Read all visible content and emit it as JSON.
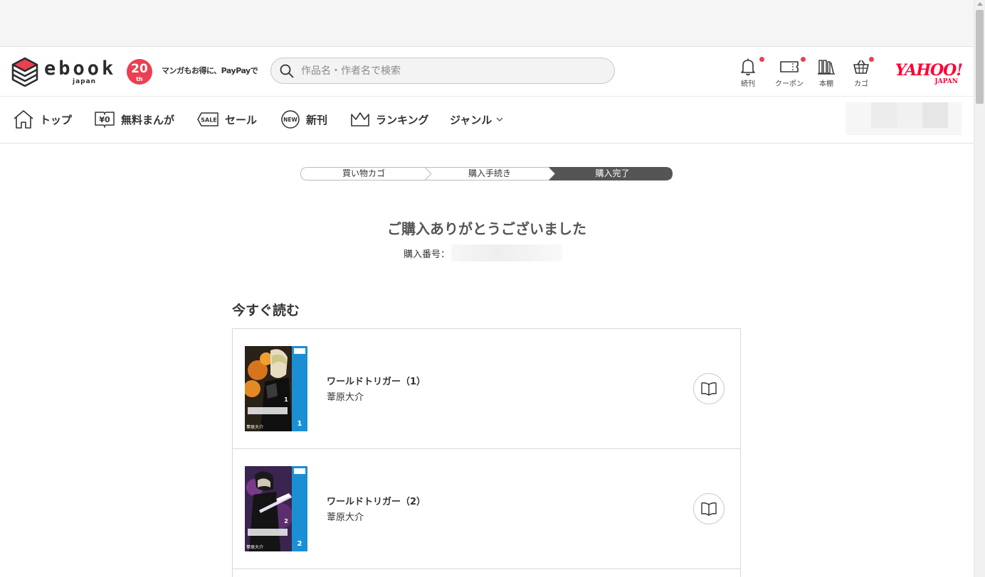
{
  "header": {
    "logo_text": "ebook",
    "logo_sub": "japan",
    "anniversary_number": "20",
    "anniversary_suffix": "th",
    "tagline": "マンガもお得に、PayPayで",
    "search_placeholder": "作品名・作者名で検索",
    "icons": [
      {
        "label": "続刊",
        "icon": "bell-icon",
        "has_notification": true
      },
      {
        "label": "クーポン",
        "icon": "coupon-icon",
        "has_notification": true
      },
      {
        "label": "本棚",
        "icon": "bookshelf-icon",
        "has_notification": false
      },
      {
        "label": "カゴ",
        "icon": "cart-icon",
        "has_notification": true
      }
    ],
    "yahoo_main": "YAHOO!",
    "yahoo_sub": "JAPAN"
  },
  "nav": {
    "items": [
      {
        "label": "トップ",
        "icon": "home-icon"
      },
      {
        "label": "無料まんが",
        "icon": "free-book-icon"
      },
      {
        "label": "セール",
        "icon": "sale-tag-icon"
      },
      {
        "label": "新刊",
        "icon": "new-badge-icon"
      },
      {
        "label": "ランキング",
        "icon": "crown-icon"
      },
      {
        "label": "ジャンル",
        "icon": "chevron-down-icon"
      }
    ]
  },
  "steps": [
    "買い物カゴ",
    "購入手続き",
    "購入完了"
  ],
  "active_step": 3,
  "thanks_title": "ご購入ありがとうございました",
  "order_label": "購入番号：",
  "section_title": "今すぐ読む",
  "books": [
    {
      "title": "ワールドトリガー（1）",
      "author": "葦原大介",
      "volume": "1",
      "cover_author": "葦原大介"
    },
    {
      "title": "ワールドトリガー（2）",
      "author": "葦原大介",
      "volume": "2",
      "cover_author": "葦原大介"
    }
  ],
  "colors": {
    "accent_red": "#eb3f52",
    "yahoo_red": "#ff0033",
    "step_active": "#555555",
    "cover_spine_blue": "#1b8fd4"
  }
}
